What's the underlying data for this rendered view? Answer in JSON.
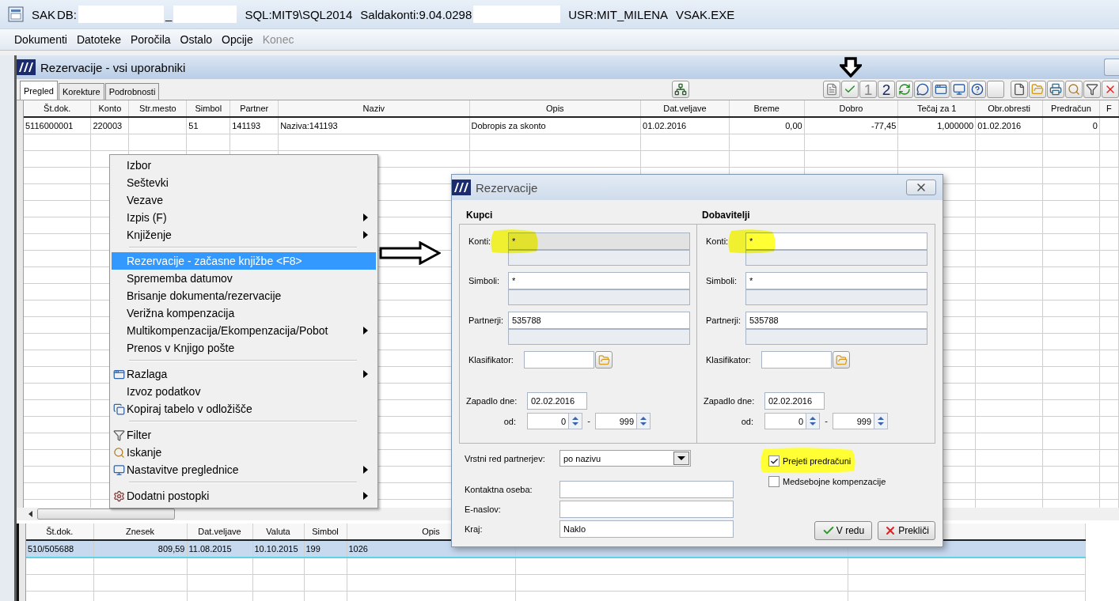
{
  "title_bar": {
    "parts": [
      {
        "kind": "text",
        "text": "SAK"
      },
      {
        "kind": "text",
        "text": "DB:"
      },
      {
        "kind": "redacted"
      },
      {
        "kind": "text",
        "text": "_"
      },
      {
        "kind": "redacted"
      },
      {
        "kind": "text",
        "text": "SQL:MIT9\\SQL2014"
      },
      {
        "kind": "text",
        "text": "Saldakonti:9.04.0298"
      },
      {
        "kind": "redacted"
      },
      {
        "kind": "text",
        "text": "USR:MIT_MILENA"
      },
      {
        "kind": "text",
        "text": "VSAK.EXE"
      }
    ]
  },
  "menu_bar": [
    {
      "label": "Dokumenti",
      "disabled": false
    },
    {
      "label": "Datoteke",
      "disabled": false
    },
    {
      "label": "Poročila",
      "disabled": false
    },
    {
      "label": "Ostalo",
      "disabled": false
    },
    {
      "label": "Opcije",
      "disabled": false
    },
    {
      "label": "Konec",
      "disabled": true
    }
  ],
  "window": {
    "title": "Rezervacije - vsi uporabniki"
  },
  "tabs": [
    {
      "label": "Pregled",
      "selected": true
    },
    {
      "label": "Korekture",
      "selected": false
    },
    {
      "label": "Podrobnosti",
      "selected": false
    }
  ],
  "toolbar_left": [
    {
      "kind": "tree"
    }
  ],
  "toolbar_right": [
    {
      "kind": "document"
    },
    {
      "kind": "check"
    },
    {
      "kind": "digit",
      "label": "1",
      "disabled": true
    },
    {
      "kind": "digit",
      "label": "2",
      "disabled": false
    },
    {
      "kind": "refresh"
    },
    {
      "kind": "speech"
    },
    {
      "kind": "window"
    },
    {
      "kind": "monitor"
    },
    {
      "kind": "help"
    },
    {
      "kind": "blank"
    },
    {
      "kind": "gap"
    },
    {
      "kind": "new"
    },
    {
      "kind": "folder"
    },
    {
      "kind": "print"
    },
    {
      "kind": "search"
    },
    {
      "kind": "filter"
    },
    {
      "kind": "close"
    }
  ],
  "top_table": {
    "columns": [
      {
        "label": "Št.dok."
      },
      {
        "label": "Konto"
      },
      {
        "label": "Str.mesto"
      },
      {
        "label": "Simbol"
      },
      {
        "label": "Partner"
      },
      {
        "label": "Naziv"
      },
      {
        "label": "Opis"
      },
      {
        "label": "Dat.veljave"
      },
      {
        "label": "Breme",
        "kind": "number"
      },
      {
        "label": "Dobro",
        "kind": "number"
      },
      {
        "label": "Tečaj za 1",
        "kind": "number"
      },
      {
        "label": "Obr.obresti"
      },
      {
        "label": "Predračun",
        "kind": "number"
      },
      {
        "label": "F"
      }
    ],
    "rows": [
      {
        "selected": false,
        "cells": [
          "5116000001",
          "220003",
          null,
          "51",
          "141193",
          "Naziva:141193",
          "Dobropis za skonto",
          "01.02.2016",
          "0,00",
          "-77,45",
          "1,000000",
          "01.02.2016",
          "0",
          null
        ]
      }
    ]
  },
  "bottom_table": {
    "columns": [
      {
        "label": "Št.dok."
      },
      {
        "label": "Znesek",
        "kind": "number"
      },
      {
        "label": "Dat.veljave"
      },
      {
        "label": "Valuta"
      },
      {
        "label": "Simbol"
      },
      {
        "label": "Opis"
      }
    ],
    "rows": [
      {
        "selected": true,
        "cells": [
          "510/505688",
          "809,59",
          "11.08.2015",
          "10.10.2015",
          "199",
          "1026"
        ]
      }
    ]
  },
  "context_menu": [
    {
      "kind": "plain",
      "label": "Izbor",
      "submenu": false,
      "selected": false
    },
    {
      "kind": "plain",
      "label": "Seštevki",
      "submenu": false,
      "selected": false
    },
    {
      "kind": "plain",
      "label": "Vezave",
      "submenu": false,
      "selected": false
    },
    {
      "kind": "plain",
      "label": "Izpis (F)",
      "submenu": true,
      "selected": false
    },
    {
      "kind": "plain",
      "label": "Knjiženje",
      "submenu": true,
      "selected": false
    },
    {
      "kind": "separator"
    },
    {
      "kind": "plain",
      "label": "Rezervacije - začasne knjižbe <F8>",
      "submenu": false,
      "selected": true
    },
    {
      "kind": "plain",
      "label": "Sprememba datumov",
      "submenu": false,
      "selected": false
    },
    {
      "kind": "plain",
      "label": "Brisanje dokumenta/rezervacije",
      "submenu": false,
      "selected": false
    },
    {
      "kind": "plain",
      "label": "Verižna kompenzacija",
      "submenu": false,
      "selected": false
    },
    {
      "kind": "plain",
      "label": "Multikompenzacija/Ekompenzacija/Pobot",
      "submenu": true,
      "selected": false
    },
    {
      "kind": "plain",
      "label": "Prenos v Knjigo pošte",
      "submenu": false,
      "selected": false
    },
    {
      "kind": "separator"
    },
    {
      "kind": "window",
      "label": "Razlaga",
      "submenu": true,
      "selected": false
    },
    {
      "kind": "plain",
      "label": "Izvoz podatkov",
      "submenu": false,
      "selected": false
    },
    {
      "kind": "copy",
      "label": "Kopiraj tabelo v odložišče",
      "submenu": false,
      "selected": false
    },
    {
      "kind": "separator"
    },
    {
      "kind": "filter",
      "label": "Filter",
      "submenu": false,
      "selected": false
    },
    {
      "kind": "search",
      "label": "Iskanje",
      "submenu": false,
      "selected": false
    },
    {
      "kind": "monitor",
      "label": "Nastavitve preglednice",
      "submenu": true,
      "selected": false
    },
    {
      "kind": "separator"
    },
    {
      "kind": "gear",
      "label": "Dodatni postopki",
      "submenu": true,
      "selected": false
    }
  ],
  "dialog": {
    "title": "Rezervacije",
    "groups": [
      {
        "heading": "Kupci",
        "filters": [
          {
            "label": "Konti:",
            "value": "*",
            "focused": true,
            "highlighted": true
          },
          {
            "label": "Simboli:",
            "value": "*",
            "focused": false,
            "highlighted": false
          },
          {
            "label": "Partnerji:",
            "value": "535788",
            "focused": false,
            "highlighted": false
          }
        ],
        "classifier": {
          "label": "Klasifikator:"
        },
        "due": {
          "label": "Zapadlo dne:",
          "value": "02.02.2016"
        },
        "range": {
          "label": "od:",
          "from": "0",
          "separator": "-",
          "to": "999"
        }
      },
      {
        "heading": "Dobavitelji",
        "filters": [
          {
            "label": "Konti:",
            "value": "*",
            "focused": false,
            "highlighted": true
          },
          {
            "label": "Simboli:",
            "value": "*",
            "focused": false,
            "highlighted": false
          },
          {
            "label": "Partnerji:",
            "value": "535788",
            "focused": false,
            "highlighted": false
          }
        ],
        "classifier": {
          "label": "Klasifikator:"
        },
        "due": {
          "label": "Zapadlo dne:",
          "value": "02.02.2016"
        },
        "range": {
          "label": "od:",
          "from": "0",
          "separator": "-",
          "to": "999"
        }
      }
    ],
    "sort": {
      "label": "Vrstni red partnerjev:",
      "value": "po nazivu"
    },
    "contact_fields": [
      {
        "label": "Kontaktna oseba:"
      },
      {
        "label": "E-naslov:"
      },
      {
        "label": "Kraj:",
        "value": "Naklo"
      }
    ],
    "checkboxes": [
      {
        "label": "Prejeti predračuni",
        "checked": true,
        "highlighted": true
      },
      {
        "label": "Medsebojne kompenzacije",
        "checked": false,
        "highlighted": false
      }
    ],
    "buttons": [
      {
        "kind": "ok",
        "label": "V redu"
      },
      {
        "kind": "cancel",
        "label": "Prekliči"
      }
    ]
  },
  "annotations": [
    {
      "kind": "right-arrow"
    },
    {
      "kind": "down-arrow"
    }
  ]
}
